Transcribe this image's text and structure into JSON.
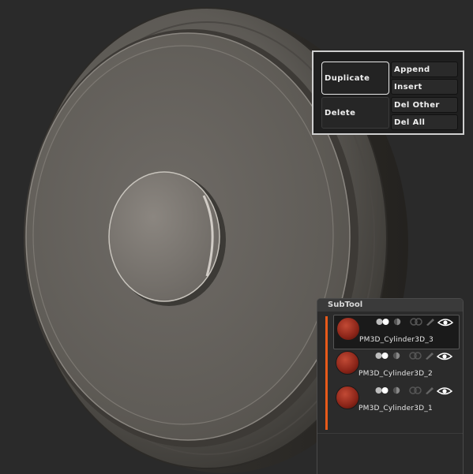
{
  "actions": {
    "duplicate": "Duplicate",
    "delete": "Delete",
    "append": "Append",
    "insert": "Insert",
    "del_other": "Del Other",
    "del_all": "Del All"
  },
  "subtool": {
    "title": "SubTool",
    "items": [
      {
        "name": "PM3D_Cylinder3D_3",
        "selected": true
      },
      {
        "name": "PM3D_Cylinder3D_2",
        "selected": false
      },
      {
        "name": "PM3D_Cylinder3D_1",
        "selected": false
      }
    ]
  },
  "colors": {
    "background": "#2a2a2a",
    "accent_scrollbar": "#e85a1a",
    "model_surface": "#6d6a64"
  }
}
